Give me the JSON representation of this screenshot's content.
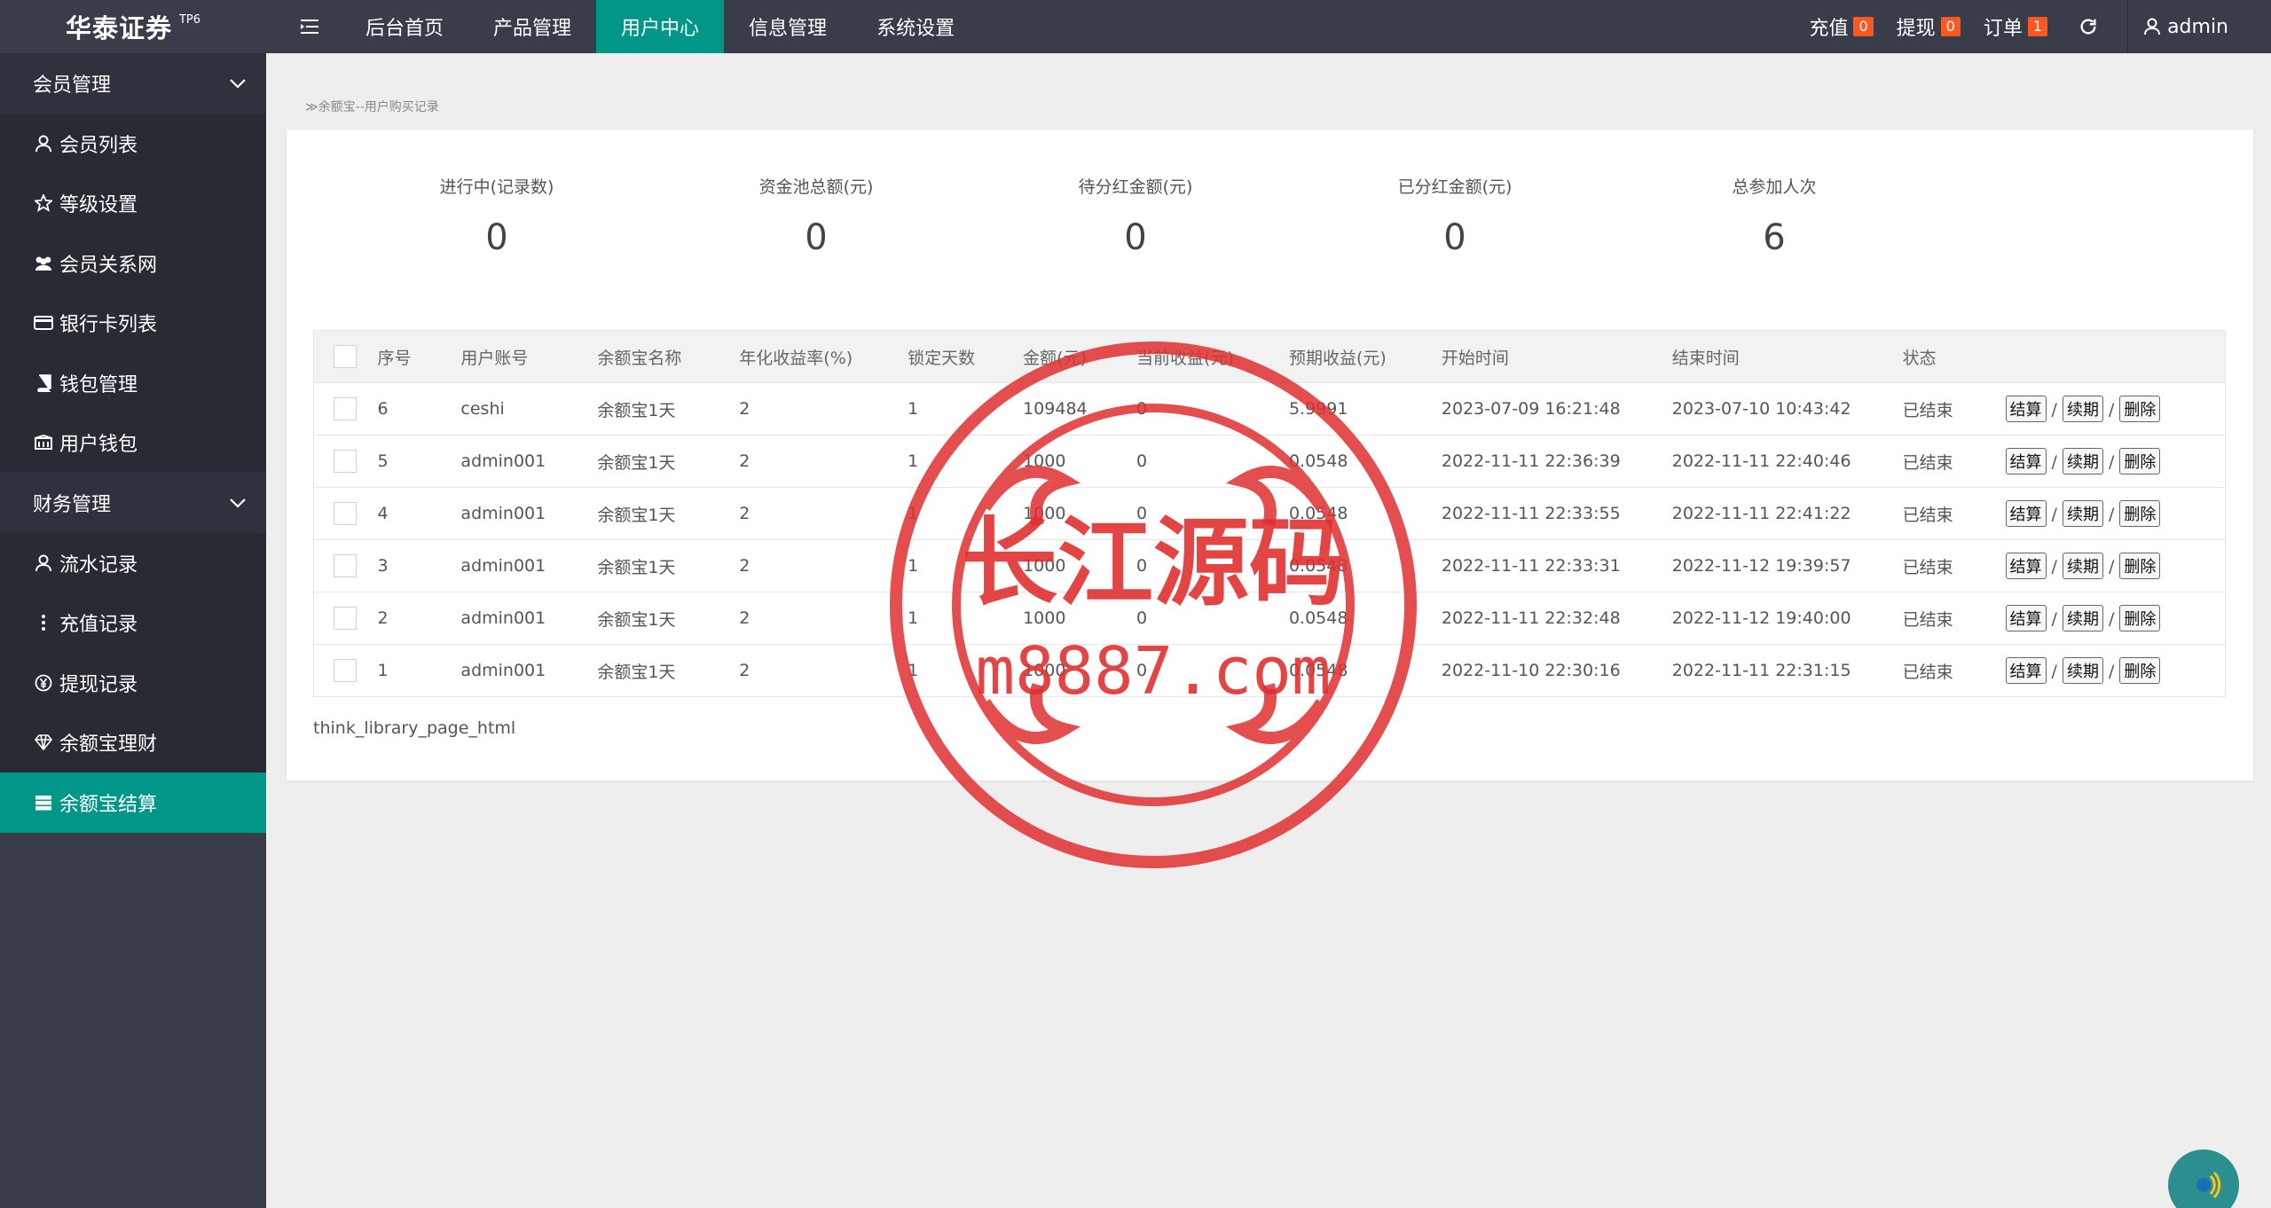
{
  "app": {
    "name": "华泰证券",
    "version": "TP6"
  },
  "nav": [
    "后台首页",
    "产品管理",
    "用户中心",
    "信息管理",
    "系统设置"
  ],
  "nav_active_index": 2,
  "right": {
    "recharge_label": "充值",
    "recharge_count": "0",
    "withdraw_label": "提现",
    "withdraw_count": "0",
    "order_label": "订单",
    "order_count": "1",
    "user": "admin"
  },
  "sidebar": {
    "group1": "会员管理",
    "group1_items": [
      {
        "label": "会员列表",
        "icon": "user-icon"
      },
      {
        "label": "等级设置",
        "icon": "star-icon"
      },
      {
        "label": "会员关系网",
        "icon": "users-icon"
      },
      {
        "label": "银行卡列表",
        "icon": "card-icon"
      },
      {
        "label": "钱包管理",
        "icon": "book-icon"
      },
      {
        "label": "用户钱包",
        "icon": "wallet-icon"
      }
    ],
    "group2": "财务管理",
    "group2_items": [
      {
        "label": "流水记录",
        "icon": "user-icon"
      },
      {
        "label": "充值记录",
        "icon": "dots-icon"
      },
      {
        "label": "提现记录",
        "icon": "yen-icon"
      },
      {
        "label": "余额宝理财",
        "icon": "diamond-icon"
      },
      {
        "label": "余额宝结算",
        "icon": "server-icon"
      }
    ]
  },
  "breadcrumb": "≫余额宝--用户购买记录",
  "stats": [
    {
      "label": "进行中(记录数)",
      "value": "0"
    },
    {
      "label": "资金池总额(元)",
      "value": "0"
    },
    {
      "label": "待分红金额(元)",
      "value": "0"
    },
    {
      "label": "已分红金额(元)",
      "value": "0"
    },
    {
      "label": "总参加人次",
      "value": "6"
    }
  ],
  "table": {
    "headers": [
      "序号",
      "用户账号",
      "余额宝名称",
      "年化收益率(%)",
      "锁定天数",
      "金额(元)",
      "当前收益(元)",
      "预期收益(元)",
      "开始时间",
      "结束时间",
      "状态"
    ],
    "rows": [
      [
        "6",
        "ceshi",
        "余额宝1天",
        "2",
        "1",
        "109484",
        "0",
        "5.9991",
        "2023-07-09 16:21:48",
        "2023-07-10 10:43:42",
        "已结束"
      ],
      [
        "5",
        "admin001",
        "余额宝1天",
        "2",
        "1",
        "1000",
        "0",
        "0.0548",
        "2022-11-11 22:36:39",
        "2022-11-11 22:40:46",
        "已结束"
      ],
      [
        "4",
        "admin001",
        "余额宝1天",
        "2",
        "1",
        "1000",
        "0",
        "0.0548",
        "2022-11-11 22:33:55",
        "2022-11-11 22:41:22",
        "已结束"
      ],
      [
        "3",
        "admin001",
        "余额宝1天",
        "2",
        "1",
        "1000",
        "0",
        "0.0548",
        "2022-11-11 22:33:31",
        "2022-11-12 19:39:57",
        "已结束"
      ],
      [
        "2",
        "admin001",
        "余额宝1天",
        "2",
        "1",
        "1000",
        "0",
        "0.0548",
        "2022-11-11 22:32:48",
        "2022-11-12 19:40:00",
        "已结束"
      ],
      [
        "1",
        "admin001",
        "余额宝1天",
        "2",
        "1",
        "1000",
        "0",
        "0.0548",
        "2022-11-10 22:30:16",
        "2022-11-11 22:31:15",
        "已结束"
      ]
    ],
    "actions": [
      "结算",
      "续期",
      "删除"
    ],
    "action_sep": "/"
  },
  "pager_text": "think_library_page_html",
  "watermark": {
    "line1": "长江源码",
    "line2": "m8887.com",
    "color": "#e03030"
  },
  "colors": {
    "header": "#393d49",
    "accent": "#009688",
    "badge": "#ff5722"
  }
}
